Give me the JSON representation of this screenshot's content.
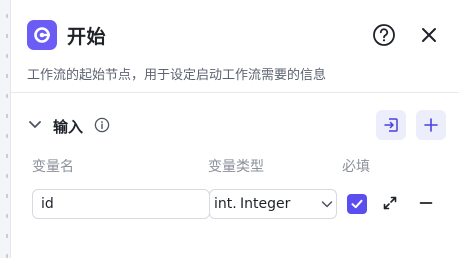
{
  "header": {
    "title": "开始",
    "description": "工作流的起始节点，用于设定启动工作流需要的信息",
    "logo_icon": "start-node-icon",
    "help_icon": "help-circle-icon",
    "close_icon": "close-icon"
  },
  "inputs_section": {
    "title": "输入",
    "columns": {
      "name": "变量名",
      "type": "变量类型",
      "required": "必填"
    },
    "rows": [
      {
        "name_value": "id",
        "type_glyph": "int.",
        "type_label": "Integer",
        "required": true
      }
    ]
  },
  "colors": {
    "accent": "#5b4ef0",
    "logo_bg": "#6b5cf6",
    "button_bg": "#eceefc"
  }
}
